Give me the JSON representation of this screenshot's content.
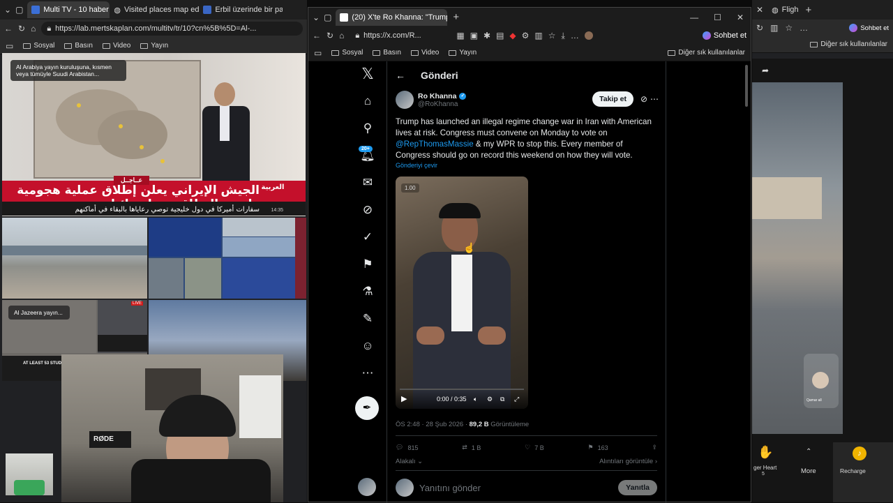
{
  "left_browser": {
    "tabs": [
      {
        "label": "Multi TV - 10 haber k",
        "active": true
      },
      {
        "label": "Visited places map editor",
        "active": false
      },
      {
        "label": "Erbil üzerinde bir patlama",
        "active": false
      }
    ],
    "url": "https://lab.mertskaplan.com/multitv/tr/10?cn%5B%5D=Al-...",
    "bookmarks": [
      "Sosyal",
      "Basın",
      "Video",
      "Yayın"
    ]
  },
  "tv": {
    "chip1": "Al Arabiya yayın kuruluşuna, kısmen veya tümüyle Suudi Arabistan...",
    "headline_ar": "الجيش الإيراني يعلن إطلاق عملية هجومية واسعة النطاق ضد إسرائيل",
    "sub_ar": "سفارات أميركا في دول خليجية توصي رعاياها بالبقاء في أماكنهم",
    "urgent_ar": "عــاجــل",
    "logo_ar": "العربية",
    "time": "14:35",
    "chip2": "Al Jazeera yayın...",
    "live": "LIVE",
    "ticker": "AT LEAST 53 STUDE..."
  },
  "x_window": {
    "tab_label": "(20) X'te Ro Khanna: \"Trump has la",
    "url": "https://x.com/R...",
    "bookmarks": [
      "Sosyal",
      "Basın",
      "Video",
      "Yayın"
    ],
    "other_bookmarks": "Diğer sık kullanılanlar",
    "copilot": "Sohbet et",
    "badge": "20+",
    "header_title": "Gönderi",
    "author_name": "Ro Khanna",
    "author_handle": "@RoKhanna",
    "follow_label": "Takip et",
    "tweet_part1": "Trump has launched an illegal regime change war in Iran with American lives at risk. Congress must convene on Monday to vote on ",
    "tweet_mention": "@RepThomasMassie",
    "tweet_part2": " & my WPR to stop this. Every member of Congress should go on record this weekend on how they will vote.",
    "translate": "Gönderiyi çevir",
    "video_speed": "1.00",
    "video_time": "0:00 / 0:35",
    "date": "ÖS 2:48 · 28 Şub 2026 · ",
    "views": "89,2 B",
    "views_label": " Görüntüleme",
    "replies": "815",
    "reposts": "1 B",
    "likes": "7 B",
    "bookmarks_count": "163",
    "relevance": "Alakalı",
    "quotes": "Alıntıları görüntüle",
    "reply_placeholder": "Yanıtını gönder",
    "reply_btn": "Yanıtla"
  },
  "right_browser": {
    "tab_label": "Fligh",
    "copilot": "Sohbet et",
    "other_bookmarks": "Diğer sık kullanılanlar",
    "gift1": "ger Heart",
    "gift1_count": "5",
    "more": "More",
    "recharge": "Recharge",
    "guest_label": "Qamar all"
  }
}
